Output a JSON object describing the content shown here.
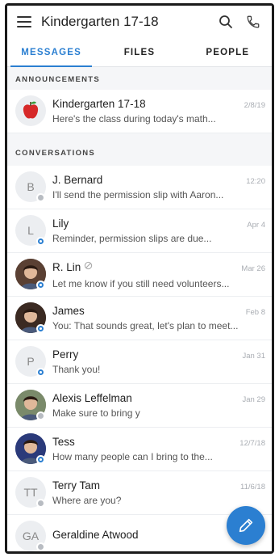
{
  "header": {
    "title": "Kindergarten 17-18",
    "icons": [
      "menu-icon",
      "search-icon",
      "phone-icon"
    ]
  },
  "tabs": [
    {
      "label": "MESSAGES",
      "active": true
    },
    {
      "label": "FILES",
      "active": false
    },
    {
      "label": "PEOPLE",
      "active": false
    }
  ],
  "announcements": {
    "header": "ANNOUNCEMENTS",
    "items": [
      {
        "name": "Kindergarten 17-18",
        "date": "2/8/19",
        "preview": "Here's the class during today's math..."
      }
    ]
  },
  "conversations": {
    "header": "CONVERSATIONS",
    "items": [
      {
        "initials": "B",
        "name": "J. Bernard",
        "date": "12:20",
        "preview": "I'll send the permission slip with Aaron...",
        "avatar_color": "#eceef1",
        "status": "offline"
      },
      {
        "initials": "L",
        "name": "Lily",
        "date": "Apr 4",
        "preview": "Reminder, permission slips are due...",
        "avatar_color": "#eceef1",
        "status": "active"
      },
      {
        "initials": "",
        "name": "R. Lin",
        "date": "Mar 26",
        "preview": "Let me know if you still need volunteers...",
        "avatar_color": "#5a4033",
        "status": "active",
        "muted": true
      },
      {
        "initials": "",
        "name": "James",
        "date": "Feb 8",
        "preview": "You: That sounds great, let's plan to meet...",
        "avatar_color": "#3b2a22",
        "status": "active"
      },
      {
        "initials": "P",
        "name": "Perry",
        "date": "Jan 31",
        "preview": "Thank you!",
        "avatar_color": "#eceef1",
        "status": "active"
      },
      {
        "initials": "",
        "name": "Alexis Leffelman",
        "date": "Jan 29",
        "preview": "Make sure to bring y",
        "avatar_color": "#7a8a6a",
        "status": "offline"
      },
      {
        "initials": "",
        "name": "Tess",
        "date": "12/7/18",
        "preview": "How many people can I bring to the...",
        "avatar_color": "#2b3a7a",
        "status": "active"
      },
      {
        "initials": "TT",
        "name": "Terry Tam",
        "date": "11/6/18",
        "preview": "Where are you?",
        "avatar_color": "#eceef1",
        "status": "offline"
      },
      {
        "initials": "GA",
        "name": "Geraldine Atwood",
        "date": "",
        "preview": "",
        "avatar_color": "#eceef1",
        "status": "offline"
      }
    ]
  },
  "fab": {
    "icon": "pencil-icon"
  },
  "colors": {
    "accent": "#2b7fd1",
    "background": "#f5f6f8"
  }
}
